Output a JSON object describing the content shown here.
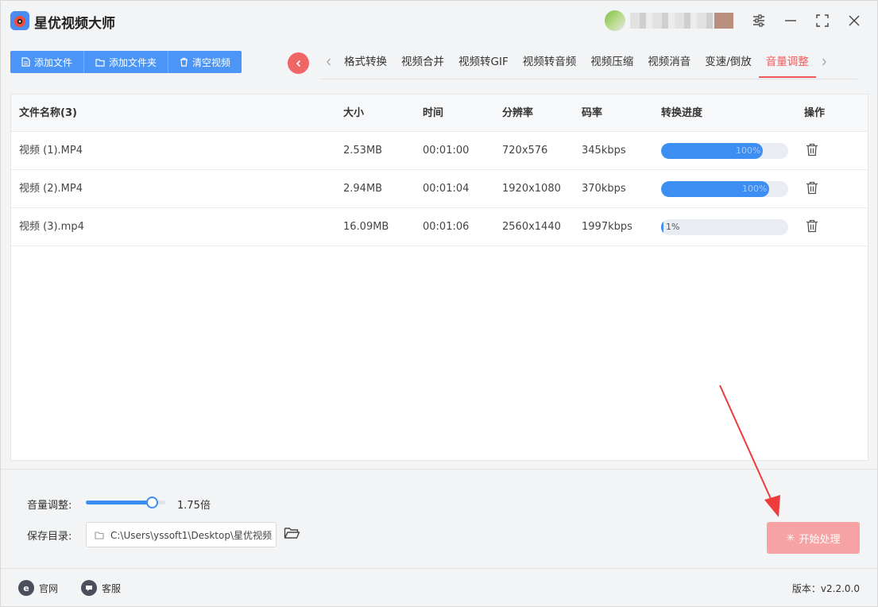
{
  "app": {
    "title": "星优视频大师",
    "accent_color": "#4a95f6",
    "active_color": "#f05a5a"
  },
  "window_controls": {
    "settings_icon": "sliders-icon",
    "minimize_icon": "minimize-icon",
    "maximize_icon": "maximize-icon",
    "close_icon": "close-icon"
  },
  "toolbar": {
    "add_file": "添加文件",
    "add_folder": "添加文件夹",
    "clear_videos": "清空视频"
  },
  "tabs": [
    {
      "label": "格式转换",
      "active": false
    },
    {
      "label": "视频合并",
      "active": false
    },
    {
      "label": "视频转GIF",
      "active": false
    },
    {
      "label": "视频转音频",
      "active": false
    },
    {
      "label": "视频压缩",
      "active": false
    },
    {
      "label": "视频消音",
      "active": false
    },
    {
      "label": "变速/倒放",
      "active": false
    },
    {
      "label": "音量调整",
      "active": true
    }
  ],
  "table": {
    "headers": {
      "name": "文件名称(3)",
      "size": "大小",
      "time": "时间",
      "resolution": "分辨率",
      "bitrate": "码率",
      "progress": "转换进度",
      "action": "操作"
    },
    "rows": [
      {
        "name": "视频 (1).MP4",
        "size": "2.53MB",
        "time": "00:01:00",
        "resolution": "720x576",
        "bitrate": "345kbps",
        "progress_label": "100%",
        "progress_fraction": 0.8
      },
      {
        "name": "视频 (2).MP4",
        "size": "2.94MB",
        "time": "00:01:04",
        "resolution": "1920x1080",
        "bitrate": "370kbps",
        "progress_label": "100%",
        "progress_fraction": 0.85
      },
      {
        "name": "视频 (3).mp4",
        "size": "16.09MB",
        "time": "00:01:06",
        "resolution": "2560x1440",
        "bitrate": "1997kbps",
        "progress_label": "1%",
        "progress_fraction": 0.01
      }
    ]
  },
  "volume": {
    "label": "音量调整:",
    "value": "1.75倍",
    "slider_fraction": 0.83
  },
  "output": {
    "label": "保存目录:",
    "path": "C:\\Users\\yssoft1\\Desktop\\星优视频"
  },
  "start_button": "开始处理",
  "footer": {
    "website": "官网",
    "support": "客服",
    "version": "版本：v2.2.0.0"
  }
}
